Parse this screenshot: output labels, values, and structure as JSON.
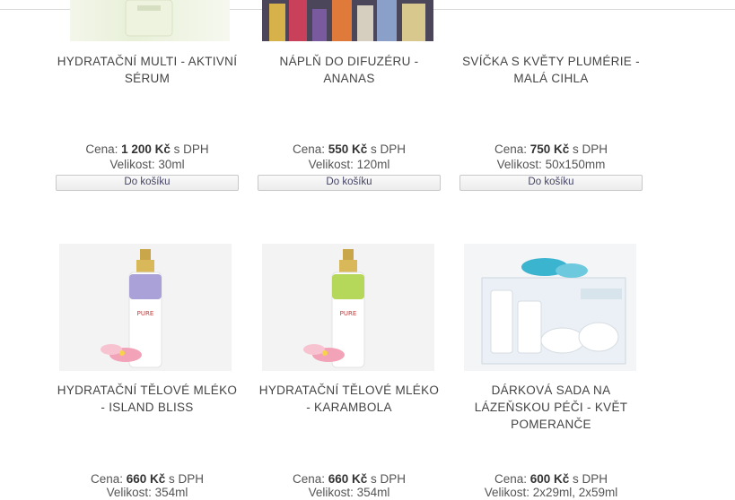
{
  "products": [
    {
      "title": "HYDRATAČNÍ MULTI - AKTIVNÍ SÉRUM",
      "price_prefix": "Cena: ",
      "price": "1 200 Kč",
      "price_suffix": " s DPH",
      "size": "Velikost: 30ml",
      "cart_label": "Do košíku",
      "image": "serum-bottle-image"
    },
    {
      "title": "NÁPLŇ DO DIFUZÉRU - ANANAS",
      "price_prefix": "Cena: ",
      "price": "550 Kč",
      "price_suffix": " s DPH",
      "size": "Velikost: 120ml",
      "cart_label": "Do košíku",
      "image": "diffuser-refill-image"
    },
    {
      "title": "SVÍČKA S KVĚTY PLUMÉRIE - MALÁ CIHLA",
      "price_prefix": "Cena: ",
      "price": "750 Kč",
      "price_suffix": " s DPH",
      "size": "Velikost: 50x150mm",
      "cart_label": "Do košíku",
      "image": ""
    },
    {
      "title": "HYDRATAČNÍ TĚLOVÉ MLÉKO - ISLAND BLISS",
      "price_prefix": "Cena: ",
      "price": "660 Kč",
      "price_suffix": " s DPH",
      "size": "Velikost: 354ml",
      "cart_label": "",
      "image": "lotion-bottle-purple-image"
    },
    {
      "title": "HYDRATAČNÍ TĚLOVÉ MLÉKO - KARAMBOLA",
      "price_prefix": "Cena: ",
      "price": "660 Kč",
      "price_suffix": " s DPH",
      "size": "Velikost: 354ml",
      "cart_label": "",
      "image": "lotion-bottle-green-image"
    },
    {
      "title": "DÁRKOVÁ SADA NA LÁZEŇSKOU PÉČI - KVĚT POMERANČE",
      "price_prefix": "Cena: ",
      "price": "600 Kč",
      "price_suffix": " s DPH",
      "size": "Velikost: 2x29ml, 2x59ml",
      "cart_label": "",
      "image": "gift-set-box-image"
    }
  ],
  "colors": {
    "lotion_purple": "#a9a1d8",
    "lotion_green": "#b6d85a",
    "accent_text": "#333333"
  }
}
